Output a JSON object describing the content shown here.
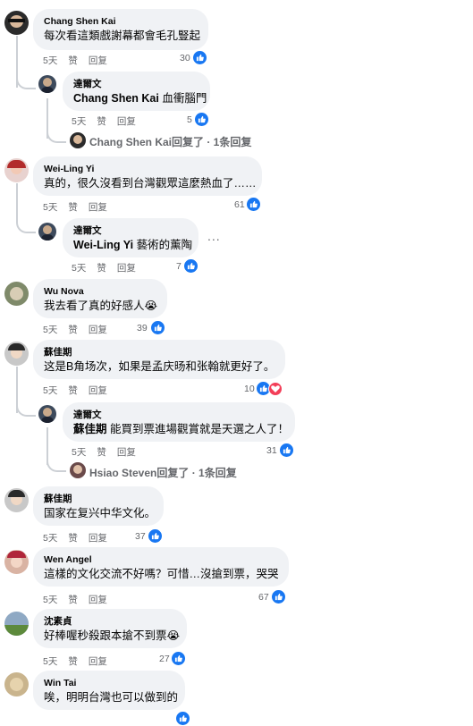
{
  "comments": [
    {
      "name": "Chang Shen Kai",
      "text": "每次看這類戲謝幕都會毛孔豎起",
      "time": "5天",
      "like": "赞",
      "reply": "回复",
      "count": "30"
    },
    {
      "name": "達爾文",
      "mention": "Chang Shen Kai",
      "text": " 血衝腦門",
      "time": "5天",
      "like": "赞",
      "reply": "回复",
      "count": "5"
    },
    {
      "name": "Wei-Ling Yi",
      "text": "真的，很久沒看到台灣觀眾這麼熱血了……",
      "time": "5天",
      "like": "赞",
      "reply": "回复",
      "count": "61"
    },
    {
      "name": "達爾文",
      "mention": "Wei-Ling Yi",
      "text": " 藝術的薰陶",
      "time": "5天",
      "like": "赞",
      "reply": "回复",
      "count": "7"
    },
    {
      "name": "Wu Nova",
      "text": "我去看了真的好感人😭",
      "time": "5天",
      "like": "赞",
      "reply": "回复",
      "count": "39"
    },
    {
      "name": "蘇佳期",
      "text": "这是B角场次，如果是孟庆旸和张翰就更好了。",
      "time": "5天",
      "like": "赞",
      "reply": "回复",
      "count": "10"
    },
    {
      "name": "達爾文",
      "mention": "蘇佳期",
      "text": " 能買到票進場觀賞就是天選之人了！",
      "time": "5天",
      "like": "赞",
      "reply": "回复",
      "count": "31"
    },
    {
      "name": "蘇佳期",
      "text": "国家在复兴中华文化。",
      "time": "5天",
      "like": "赞",
      "reply": "回复",
      "count": "37"
    },
    {
      "name": "Wen Angel",
      "text": "這樣的文化交流不好嗎？可惜…沒搶到票，哭哭",
      "time": "5天",
      "like": "赞",
      "reply": "回复",
      "count": "67"
    },
    {
      "name": "沈素貞",
      "text": "好棒喔秒殺跟本搶不到票😭",
      "time": "5天",
      "like": "赞",
      "reply": "回复",
      "count": "27"
    },
    {
      "name": "Win Tai",
      "text": "唉，明明台灣也可以做到的",
      "count": ""
    }
  ],
  "view_replies": [
    {
      "name": "Chang Shen Kai",
      "text": "回复了 · 1条回复"
    },
    {
      "name": "Hsiao Steven",
      "text": "回复了 · 1条回复"
    }
  ],
  "more_dots": "...",
  "colors": {
    "like": "#1877f2",
    "love": "#f33e58",
    "bubble": "#f0f2f5",
    "meta": "#65676b"
  }
}
